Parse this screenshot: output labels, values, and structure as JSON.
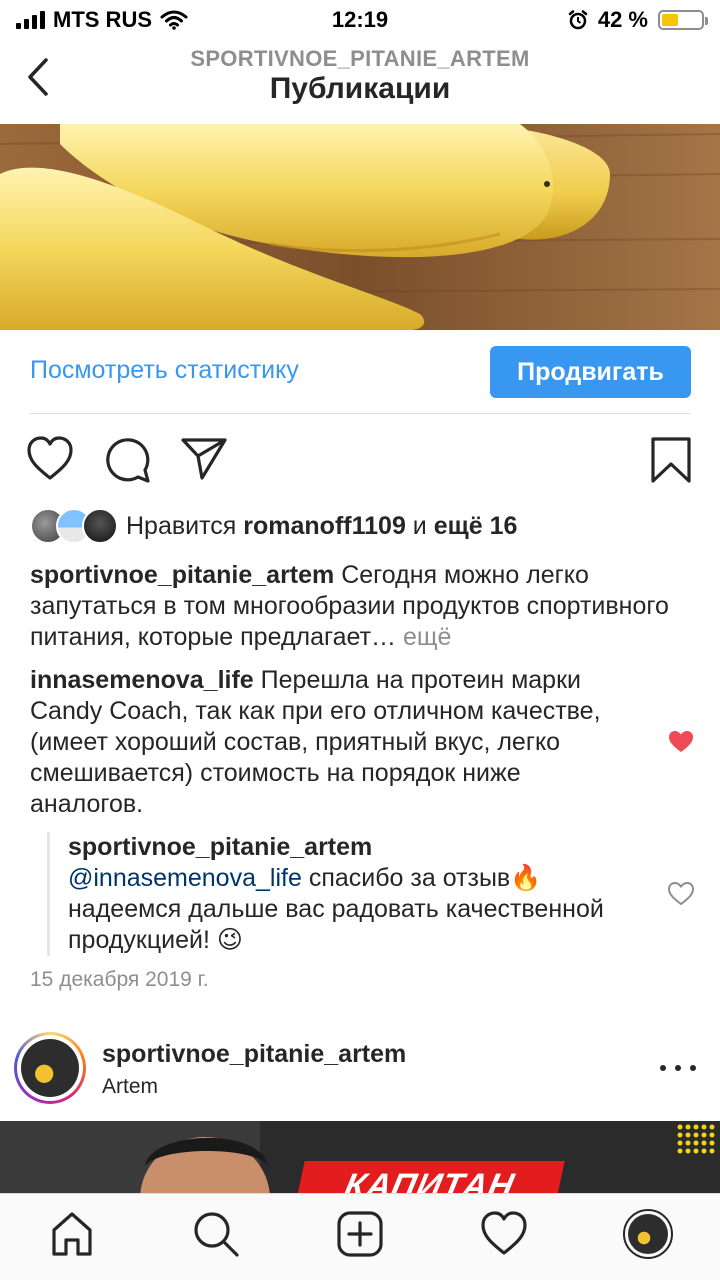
{
  "status_bar": {
    "carrier": "MTS RUS",
    "time": "12:19",
    "battery": "42 %",
    "battery_level": 0.42
  },
  "header": {
    "subtitle": "SPORTIVNOE_PITANIE_ARTEM",
    "title": "Публикации"
  },
  "insights": {
    "stats_label": "Посмотреть статистику",
    "promote_label": "Продвигать"
  },
  "likes": {
    "prefix": "Нравится",
    "user": "romanoff1109",
    "conj": "и",
    "others": "ещё 16"
  },
  "caption": {
    "user": "sportivnoe_pitanie_artem",
    "text": "Сегодня можно легко запутаться в том многообразии продуктов спортивного питания, которые предлагает…",
    "more": "ещё"
  },
  "comment": {
    "user": "innasemenova_life",
    "text": "Перешла на протеин марки Candy Coach, так как при его отличном качестве, (имеет хороший состав, приятный вкус, легко смешивается) стоимость на порядок ниже аналогов."
  },
  "reply": {
    "user": "sportivnoe_pitanie_artem",
    "mention": "@innasemenova_life",
    "text": "спасибо за отзыв🔥 надеемся дальше вас радовать качественной продукцией! 😉"
  },
  "date": "15 декабря 2019 г.",
  "next_post": {
    "user": "sportivnoe_pitanie_artem",
    "location": "Artem",
    "image_text": "КАПИТАН"
  },
  "colors": {
    "accent": "#3897f0",
    "like_red": "#ed4956",
    "muted": "#8e8e8e",
    "text": "#262626"
  },
  "tabbar": {
    "items": [
      "home-icon",
      "search-icon",
      "add-post-icon",
      "activity-heart-icon",
      "profile-avatar"
    ]
  }
}
